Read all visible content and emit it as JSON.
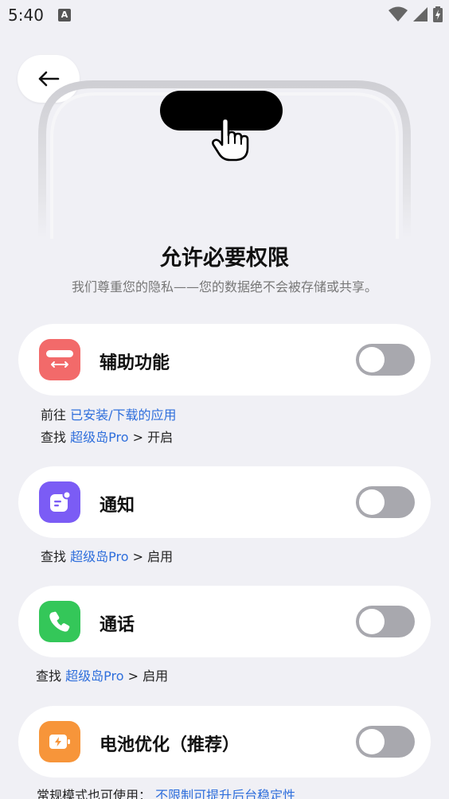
{
  "status_bar": {
    "time": "5:40",
    "app_badge": "A"
  },
  "header": {
    "back_icon": "arrow-left-icon"
  },
  "title": "允许必要权限",
  "subtitle": "我们尊重您的隐私——您的数据绝不会被存储或共享。",
  "permissions": [
    {
      "label": "辅助功能",
      "icon": "accessibility-icon",
      "icon_color": "#f26a6a",
      "enabled": false,
      "hint_lines": [
        {
          "prefix": "前往 ",
          "link": "已安装/下载的应用",
          "suffix": ""
        },
        {
          "prefix": "查找 ",
          "link": "超级岛Pro",
          "suffix": " > 开启"
        }
      ]
    },
    {
      "label": "通知",
      "icon": "notification-icon",
      "icon_color": "#7b5cf5",
      "enabled": false,
      "hint_lines": [
        {
          "prefix": "查找 ",
          "link": "超级岛Pro",
          "suffix": " > 启用"
        }
      ]
    },
    {
      "label": "通话",
      "icon": "phone-icon",
      "icon_color": "#34c759",
      "enabled": false,
      "hint_lines": [
        {
          "prefix": "查找 ",
          "link": "超级岛Pro",
          "suffix": " > 启用"
        }
      ]
    },
    {
      "label": "电池优化（推荐）",
      "icon": "battery-icon",
      "icon_color": "#f7953a",
      "enabled": false,
      "hint_lines": [
        {
          "prefix": "常规模式也可使用： ",
          "link": "不限制可提升后台稳定性",
          "suffix": ""
        }
      ]
    }
  ],
  "colors": {
    "background": "#f0f0f5",
    "link": "#2f6fdc",
    "toggle_off": "#a8a8ae"
  }
}
